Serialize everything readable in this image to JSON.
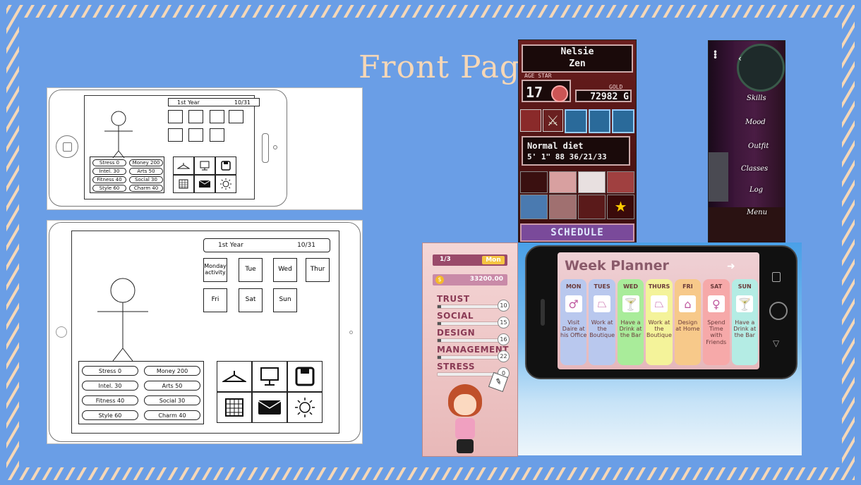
{
  "title": "Front Page UI",
  "colors": {
    "background": "#6a9ee6",
    "title": "#f6d7b6",
    "border_stroke": "#f6d7b6"
  },
  "wire_small": {
    "year": "1st Year",
    "date": "10/31",
    "stats_left": [
      "Stress 0",
      "Intel. 30",
      "Fitness 40",
      "Style 60"
    ],
    "stats_right": [
      "Money 200",
      "Arts 50",
      "Social 30",
      "Charm 40"
    ],
    "icons": [
      "hanger-icon",
      "computer-icon",
      "save-icon",
      "calendar-icon",
      "mail-icon",
      "sun-icon"
    ]
  },
  "wire_large": {
    "year": "1st Year",
    "date": "10/31",
    "days": [
      "Monday activity",
      "Tue",
      "Wed",
      "Thur",
      "Fri",
      "Sat",
      "Sun"
    ],
    "stats_left": [
      "Stress 0",
      "Intel. 30",
      "Fitness 40",
      "Style 60"
    ],
    "stats_right": [
      "Money 200",
      "Arts 50",
      "Social 30",
      "Charm 40"
    ]
  },
  "pixel": {
    "name1": "Nelsie",
    "name2": "Zen",
    "age_label": "AGE",
    "star_label": "STAR",
    "age": "17",
    "gold_label": "GOLD",
    "gold": "72982 G",
    "diet": "Normal diet",
    "body": "5' 1\" 88 36/21/33",
    "schedule": "SCHEDULE"
  },
  "dark_menu": {
    "items": [
      "Skills",
      "Mood",
      "Outfit",
      "Classes",
      "Log",
      "Menu"
    ]
  },
  "stats_phone": {
    "turn": "1/3",
    "day": "Mon",
    "money": "33200.00",
    "stats": [
      {
        "label": "TRUST",
        "value": "10",
        "fill": 0.05
      },
      {
        "label": "SOCIAL",
        "value": "15",
        "fill": 0.05
      },
      {
        "label": "DESIGN",
        "value": "16",
        "fill": 0.05
      },
      {
        "label": "MANAGEMENT",
        "value": "22",
        "fill": 0.05
      },
      {
        "label": "STRESS",
        "value": "0",
        "fill": 0.0
      }
    ]
  },
  "planner": {
    "title": "Week Planner",
    "days": [
      {
        "name": "MON",
        "text": "Visit Daire at his Office",
        "color": "#b9c8ee",
        "icon": "person-icon"
      },
      {
        "name": "TUES",
        "text": "Work at the Boutique",
        "color": "#b9c8ee",
        "icon": "hanger-icon"
      },
      {
        "name": "WED",
        "text": "Have a Drink at the Bar",
        "color": "#a9ec9a",
        "icon": "cocktail-icon"
      },
      {
        "name": "THURS",
        "text": "Work at the Boutique",
        "color": "#f4f39a",
        "icon": "hanger-icon"
      },
      {
        "name": "FRI",
        "text": "Design at Home",
        "color": "#f7c98a",
        "icon": "house-icon"
      },
      {
        "name": "SAT",
        "text": "Spend Time with Friends",
        "color": "#f6a9a9",
        "icon": "woman-icon"
      },
      {
        "name": "SUN",
        "text": "Have a Drink at the Bar",
        "color": "#b4ece4",
        "icon": "cocktail-icon"
      }
    ]
  }
}
